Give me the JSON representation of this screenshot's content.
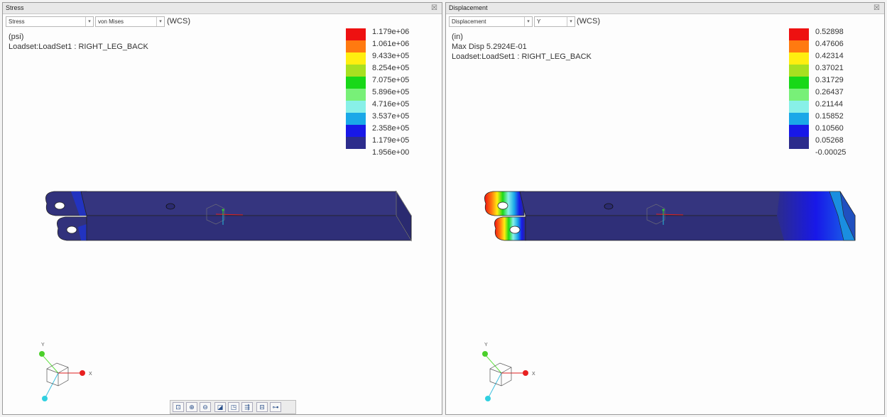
{
  "stress_panel": {
    "title": "Stress",
    "close_glyph": "☒",
    "quantity_dropdown": "Stress",
    "component_dropdown": "von Mises",
    "coord_system": "(WCS)",
    "units": "(psi)",
    "loadset": "Loadset:LoadSet1 :  RIGHT_LEG_BACK",
    "legend": {
      "labels": [
        "1.179e+06",
        "1.061e+06",
        "9.433e+05",
        "8.254e+05",
        "7.075e+05",
        "5.896e+05",
        "4.716e+05",
        "3.537e+05",
        "2.358e+05",
        "1.179e+05",
        "1.956e+00"
      ],
      "colors": [
        "#ee1111",
        "#ff7a10",
        "#ffee10",
        "#a8e020",
        "#18d818",
        "#78f078",
        "#88f0e8",
        "#1aa8e8",
        "#1818e8",
        "#2c2c8c"
      ]
    },
    "triad_labels": {
      "x": "X",
      "y": "Y"
    }
  },
  "displacement_panel": {
    "title": "Displacement",
    "close_glyph": "☒",
    "quantity_dropdown": "Displacement",
    "component_dropdown": "Y",
    "coord_system": "(WCS)",
    "units": "(in)",
    "max_disp": "Max Disp  5.2924E-01",
    "loadset": "Loadset:LoadSet1 :  RIGHT_LEG_BACK",
    "legend": {
      "labels": [
        "0.52898",
        "0.47606",
        "0.42314",
        "0.37021",
        "0.31729",
        "0.26437",
        "0.21144",
        "0.15852",
        "0.10560",
        "0.05268",
        "-0.00025"
      ],
      "colors": [
        "#ee1111",
        "#ff7a10",
        "#ffee10",
        "#a8e020",
        "#18d818",
        "#78f078",
        "#88f0e8",
        "#1aa8e8",
        "#1818e8",
        "#2c2c8c"
      ]
    },
    "triad_labels": {
      "x": "X",
      "y": "Y"
    }
  },
  "bottom_toolbar": {
    "buttons": [
      "refit-icon",
      "zoom-in-icon",
      "zoom-out-icon",
      "pan-zoom-icon",
      "view-icon",
      "spin-center-icon",
      "orient-icon",
      "display-style-icon"
    ]
  }
}
